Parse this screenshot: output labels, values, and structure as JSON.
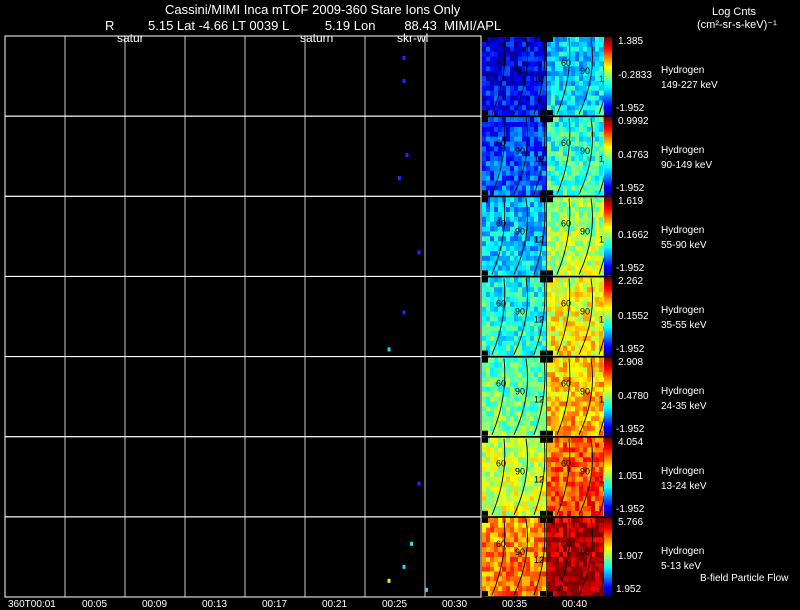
{
  "header": {
    "title": "Cassini/MIMI Inca mTOF  2009-360   Stare    Ions Only",
    "r_label": "R",
    "position_line": "5.15 Lat -4.66 LT 0039 L          5.19 Lon        88.43  MIMI/APL",
    "ind_satur_1": "satur",
    "ind_saturn": "saturn",
    "ind_skr": "skr-wl",
    "units_title": "Log Cnts",
    "units_line": "(cm²-sr-s-keV)⁻¹"
  },
  "footer": {
    "legend_note": "B-field Particle Flow"
  },
  "colors": {
    "grid": "#ffffff",
    "background": "#000000"
  },
  "chart_data": {
    "type": "heatmap",
    "x_tick_labels": [
      "360T00:01",
      "00:05",
      "00:09",
      "00:13",
      "00:17",
      "00:21",
      "00:25",
      "00:30",
      "00:35",
      "00:40"
    ],
    "panels": [
      {
        "species": "Hydrogen",
        "energy": "149-227 keV",
        "cmax": "1.385",
        "cmid": "-0.2833",
        "cmin": "-1.952",
        "level": 0.1,
        "points": [
          {
            "t": "00:27.5",
            "c": "blue"
          },
          {
            "t": "00:27.5",
            "c": "blue"
          }
        ]
      },
      {
        "species": "Hydrogen",
        "energy": "90-149 keV",
        "cmax": "0.9992",
        "cmid": "0.4763",
        "cmin": "-1.952",
        "level": 0.18,
        "points": [
          {
            "t": "00:27.7",
            "c": "blue"
          },
          {
            "t": "00:27.2",
            "c": "blue"
          }
        ]
      },
      {
        "species": "Hydrogen",
        "energy": "55-90 keV",
        "cmax": "1.619",
        "cmid": "0.1662",
        "cmin": "-1.952",
        "level": 0.3,
        "points": [
          {
            "t": "00:28.5",
            "c": "blue"
          }
        ]
      },
      {
        "species": "Hydrogen",
        "energy": "35-55 keV",
        "cmax": "2.262",
        "cmid": "0.1552",
        "cmin": "-1.952",
        "level": 0.38,
        "points": [
          {
            "t": "00:26.5",
            "c": "cyan"
          },
          {
            "t": "00:27.5",
            "c": "blue"
          }
        ]
      },
      {
        "species": "Hydrogen",
        "energy": "24-35 keV",
        "cmax": "2.908",
        "cmid": "0.4780",
        "cmin": "-1.952",
        "level": 0.45,
        "points": []
      },
      {
        "species": "Hydrogen",
        "energy": "13-24 keV",
        "cmax": "4.054",
        "cmid": "1.051",
        "cmin": "-1.952",
        "level": 0.55,
        "points": [
          {
            "t": "00:28.5",
            "c": "blue"
          }
        ]
      },
      {
        "species": "Hydrogen",
        "energy": "5-13 keV",
        "cmax": "5.766",
        "cmid": "1.907",
        "cmin": "1.952",
        "level": 0.72,
        "points": [
          {
            "t": "00:26.5",
            "c": "yellow"
          },
          {
            "t": "00:28.0",
            "c": "cyan"
          },
          {
            "t": "00:27.5",
            "c": "cyan"
          },
          {
            "t": "00:29.0",
            "c": "cyan"
          }
        ]
      }
    ],
    "contour_labels": [
      "60",
      "90",
      "12"
    ]
  }
}
